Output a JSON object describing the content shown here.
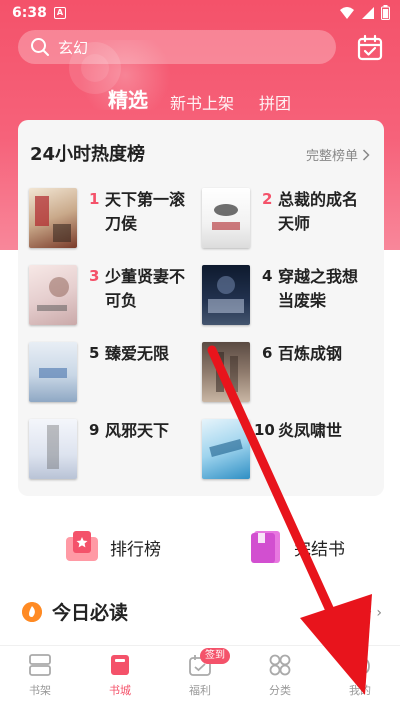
{
  "status_bar": {
    "time": "6:38",
    "notification_glyph": "A",
    "icons": [
      "wifi-icon",
      "signal-icon",
      "battery-icon"
    ]
  },
  "header": {
    "search_placeholder": "玄幻",
    "calendar_icon": "calendar-icon",
    "tabs": [
      {
        "label": "精选",
        "active": true
      },
      {
        "label": "新书上架",
        "active": false
      },
      {
        "label": "拼团",
        "active": false
      }
    ]
  },
  "ranking": {
    "title": "24小时热度榜",
    "more_label": "完整榜单",
    "books": [
      {
        "rank": "1",
        "title": "天下第一滚刀侯"
      },
      {
        "rank": "2",
        "title": "总裁的成名天师"
      },
      {
        "rank": "3",
        "title": "少董贤妻不可负"
      },
      {
        "rank": "4",
        "title": "穿越之我想当废柴"
      },
      {
        "rank": "5",
        "title": "臻爱无限"
      },
      {
        "rank": "6",
        "title": "百炼成钢"
      },
      {
        "rank": "9",
        "title": "风邪天下"
      },
      {
        "rank": "10",
        "title": "炎凤啸世"
      }
    ]
  },
  "quick_links": [
    {
      "label": "排行榜",
      "icon": "ranking-icon"
    },
    {
      "label": "完结书",
      "icon": "finished-book-icon"
    }
  ],
  "section": {
    "title": "今日必读",
    "more_label": "多 ›"
  },
  "bottom_nav": {
    "items": [
      {
        "label": "书架",
        "icon": "bookshelf-icon",
        "active": false
      },
      {
        "label": "书城",
        "icon": "bookstore-icon",
        "active": true
      },
      {
        "label": "福利",
        "icon": "welfare-icon",
        "active": false,
        "badge": "签到"
      },
      {
        "label": "分类",
        "icon": "category-icon",
        "active": false
      },
      {
        "label": "我的",
        "icon": "profile-icon",
        "active": false
      }
    ]
  },
  "colors": {
    "accent": "#f4526a",
    "rank_top3": "#f4526a",
    "arrow": "#e8141c"
  }
}
